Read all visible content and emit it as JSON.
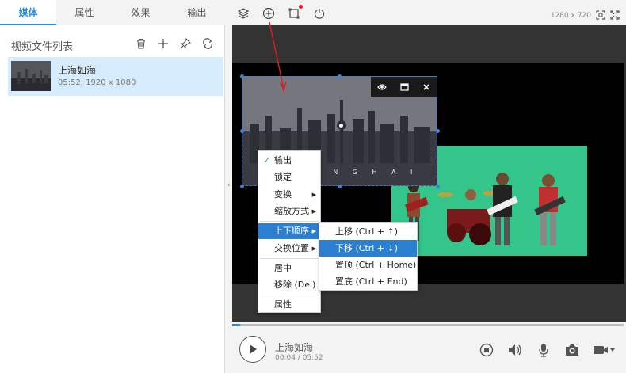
{
  "tabs": [
    {
      "label": "媒体",
      "active": true
    },
    {
      "label": "属性",
      "active": false
    },
    {
      "label": "效果",
      "active": false
    },
    {
      "label": "输出",
      "active": false
    }
  ],
  "toolbar": {
    "icons": [
      "layers-icon",
      "add-circle-icon",
      "crop-icon",
      "power-icon"
    ],
    "resolution": "1280 x 720"
  },
  "media_panel": {
    "title": "视频文件列表",
    "tools": [
      "trash-icon",
      "plus-icon",
      "pin-icon",
      "loop-icon"
    ],
    "items": [
      {
        "name": "上海如海",
        "meta": "05:52, 1920 x 1080"
      }
    ]
  },
  "preview": {
    "overlay_text": "S H A N G H A I"
  },
  "context_menu": {
    "items": [
      {
        "label": "输出",
        "checked": true,
        "submenu": false
      },
      {
        "label": "锁定",
        "checked": false,
        "submenu": false
      },
      {
        "label": "变换",
        "checked": false,
        "submenu": true
      },
      {
        "label": "缩放方式",
        "checked": false,
        "submenu": true
      },
      {
        "label": "上下顺序",
        "checked": false,
        "submenu": true,
        "highlight": true
      },
      {
        "label": "交换位置",
        "checked": false,
        "submenu": true
      },
      {
        "label": "居中",
        "checked": false,
        "submenu": false
      },
      {
        "label": "移除 (Del)",
        "checked": false,
        "submenu": false
      },
      {
        "label": "属性",
        "checked": false,
        "submenu": false
      }
    ]
  },
  "submenu": {
    "items": [
      {
        "label": "上移  (Ctrl + ↑)"
      },
      {
        "label": "下移  (Ctrl + ↓)",
        "highlight": true
      },
      {
        "label": "置顶  (Ctrl + Home)"
      },
      {
        "label": "置底  (Ctrl + End)"
      }
    ]
  },
  "player": {
    "title": "上海如海",
    "time": "00:04 / 05:52",
    "progress": 0.02,
    "colors": {
      "accent": "#2b8bdc",
      "highlight": "#2b7fd0",
      "green_screen": "#33c58a"
    }
  }
}
